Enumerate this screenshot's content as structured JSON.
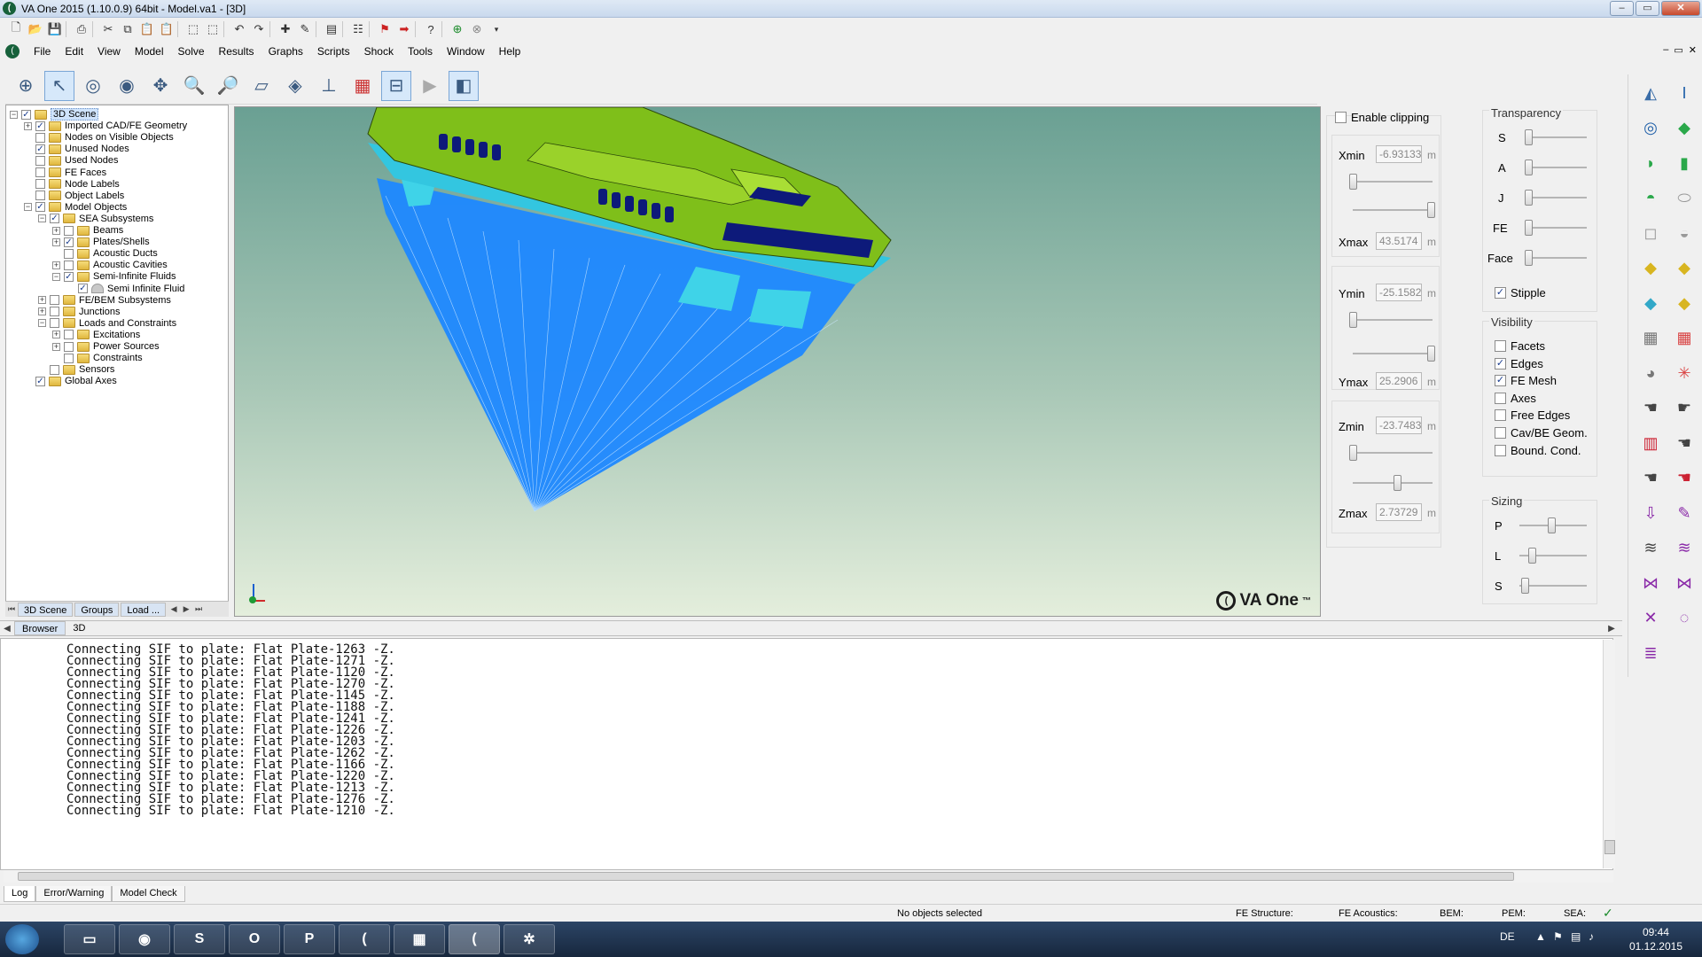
{
  "window": {
    "title": "VA One 2015 (1.10.0.9) 64bit - Model.va1 - [3D]",
    "buttons": [
      "–",
      "▭",
      "✕"
    ]
  },
  "menu": [
    "File",
    "Edit",
    "View",
    "Model",
    "Solve",
    "Results",
    "Graphs",
    "Scripts",
    "Shock",
    "Tools",
    "Window",
    "Help"
  ],
  "tree": {
    "items": [
      {
        "label": "3D Scene",
        "level": 0,
        "expander": "−",
        "checked": true,
        "selected": true
      },
      {
        "label": "Imported CAD/FE Geometry",
        "level": 1,
        "expander": "+",
        "checked": true
      },
      {
        "label": "Nodes on Visible Objects",
        "level": 1,
        "expander": "",
        "checked": false
      },
      {
        "label": "Unused Nodes",
        "level": 1,
        "expander": "",
        "checked": true
      },
      {
        "label": "Used Nodes",
        "level": 1,
        "expander": "",
        "checked": false
      },
      {
        "label": "FE Faces",
        "level": 1,
        "expander": "",
        "checked": false
      },
      {
        "label": "Node Labels",
        "level": 1,
        "expander": "",
        "checked": false
      },
      {
        "label": "Object Labels",
        "level": 1,
        "expander": "",
        "checked": false
      },
      {
        "label": "Model Objects",
        "level": 1,
        "expander": "−",
        "checked": true
      },
      {
        "label": "SEA Subsystems",
        "level": 2,
        "expander": "−",
        "checked": true
      },
      {
        "label": "Beams",
        "level": 3,
        "expander": "+",
        "checked": false
      },
      {
        "label": "Plates/Shells",
        "level": 3,
        "expander": "+",
        "checked": true
      },
      {
        "label": "Acoustic Ducts",
        "level": 3,
        "expander": "",
        "checked": false
      },
      {
        "label": "Acoustic Cavities",
        "level": 3,
        "expander": "+",
        "checked": false
      },
      {
        "label": "Semi-Infinite Fluids",
        "level": 3,
        "expander": "−",
        "checked": true
      },
      {
        "label": "Semi Infinite Fluid",
        "level": 4,
        "expander": "",
        "checked": true,
        "icon": "fluid"
      },
      {
        "label": "FE/BEM Subsystems",
        "level": 2,
        "expander": "+",
        "checked": false
      },
      {
        "label": "Junctions",
        "level": 2,
        "expander": "+",
        "checked": false
      },
      {
        "label": "Loads and Constraints",
        "level": 2,
        "expander": "−",
        "checked": false
      },
      {
        "label": "Excitations",
        "level": 3,
        "expander": "+",
        "checked": false
      },
      {
        "label": "Power Sources",
        "level": 3,
        "expander": "+",
        "checked": false
      },
      {
        "label": "Constraints",
        "level": 3,
        "expander": "",
        "checked": false
      },
      {
        "label": "Sensors",
        "level": 2,
        "expander": "",
        "checked": false
      },
      {
        "label": "Global Axes",
        "level": 1,
        "expander": "",
        "checked": true
      }
    ],
    "tabs": [
      "3D Scene",
      "Groups",
      "Load ..."
    ]
  },
  "clipping": {
    "enable_label": "Enable clipping",
    "enabled": false,
    "xmin_label": "Xmin",
    "xmin": "-6.93133",
    "xmax_label": "Xmax",
    "xmax": "43.5174",
    "ymin_label": "Ymin",
    "ymin": "-25.1582",
    "ymax_label": "Ymax",
    "ymax": "25.2906",
    "zmin_label": "Zmin",
    "zmin": "-23.7483",
    "zmax_label": "Zmax",
    "zmax": "2.73729",
    "unit": "m"
  },
  "transparency": {
    "title": "Transparency",
    "labels": [
      "S",
      "A",
      "J",
      "FE",
      "Face"
    ],
    "stipple_label": "Stipple",
    "stipple": true
  },
  "visibility": {
    "title": "Visibility",
    "items": [
      {
        "label": "Facets",
        "checked": false
      },
      {
        "label": "Edges",
        "checked": true
      },
      {
        "label": "FE Mesh",
        "checked": true
      },
      {
        "label": "Axes",
        "checked": false
      },
      {
        "label": "Free Edges",
        "checked": false
      },
      {
        "label": "Cav/BE Geom.",
        "checked": false
      },
      {
        "label": "Bound. Cond.",
        "checked": false
      }
    ]
  },
  "sizing": {
    "title": "Sizing",
    "labels": [
      "P",
      "L",
      "S"
    ]
  },
  "viewport": {
    "logo_text": "VA One",
    "logo_mark": "™"
  },
  "mid_tabs": [
    "Browser",
    "3D"
  ],
  "log": {
    "lines": [
      "Connecting SIF to plate: Flat Plate-1263 -Z.",
      "Connecting SIF to plate: Flat Plate-1271 -Z.",
      "Connecting SIF to plate: Flat Plate-1120 -Z.",
      "Connecting SIF to plate: Flat Plate-1270 -Z.",
      "Connecting SIF to plate: Flat Plate-1145 -Z.",
      "Connecting SIF to plate: Flat Plate-1188 -Z.",
      "Connecting SIF to plate: Flat Plate-1241 -Z.",
      "Connecting SIF to plate: Flat Plate-1226 -Z.",
      "Connecting SIF to plate: Flat Plate-1203 -Z.",
      "Connecting SIF to plate: Flat Plate-1262 -Z.",
      "Connecting SIF to plate: Flat Plate-1166 -Z.",
      "Connecting SIF to plate: Flat Plate-1220 -Z.",
      "Connecting SIF to plate: Flat Plate-1213 -Z.",
      "Connecting SIF to plate: Flat Plate-1276 -Z.",
      "Connecting SIF to plate: Flat Plate-1210 -Z."
    ],
    "tabs": [
      "Log",
      "Error/Warning",
      "Model Check"
    ]
  },
  "status": {
    "selection": "No objects selected",
    "fe_structure": "FE Structure:",
    "fe_acoustics": "FE Acoustics:",
    "bem": "BEM:",
    "pem": "PEM:",
    "sea": "SEA:",
    "sea_ok": "✓"
  },
  "taskbar": {
    "lang": "DE",
    "time": "09:44",
    "date": "01.12.2015"
  },
  "colors": {
    "hull_green": "#7fbf1a",
    "window_navy": "#0d1a7a",
    "fluid_blue": "#1e88ff"
  }
}
